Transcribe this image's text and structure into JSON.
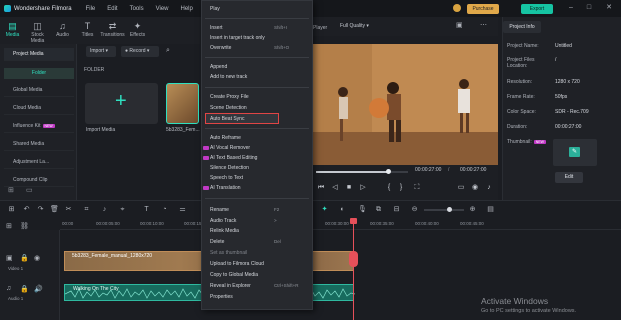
{
  "titlebar": {
    "app_name": "Wondershare Filmora",
    "menus": [
      "File",
      "Edit",
      "Tools",
      "View",
      "Help"
    ],
    "purchase": "Purchase",
    "export": "Export"
  },
  "tooltabs": [
    {
      "icon": "media-icon",
      "glyph": "▤",
      "label": "Media"
    },
    {
      "icon": "stock-media-icon",
      "glyph": "◫",
      "label": "Stock Media"
    },
    {
      "icon": "audio-icon",
      "glyph": "♫",
      "label": "Audio"
    },
    {
      "icon": "titles-icon",
      "glyph": "T",
      "label": "Titles"
    },
    {
      "icon": "transitions-icon",
      "glyph": "⇄",
      "label": "Transitions"
    },
    {
      "icon": "effects-icon",
      "glyph": "✦",
      "label": "Effects"
    }
  ],
  "leftpanel": {
    "items": [
      "Project Media",
      "Folder",
      "Global Media",
      "Cloud Media",
      "Influence Kit",
      "Shared Media",
      "Adjustment La...",
      "Compound Clip"
    ],
    "new_badge": "NEW"
  },
  "media": {
    "import_btn": "Import",
    "record_btn": "Record",
    "folder_label": "FOLDER",
    "import_media": "Import Media",
    "clip_name": "5b3283_Fem..."
  },
  "player": {
    "label": "Player",
    "quality": "Full Quality",
    "time_current": "00:00:27:00",
    "time_total": "00:00:27:00"
  },
  "context_menu": [
    {
      "label": "Play",
      "shortcut": "",
      "disabled": false,
      "ai": false
    },
    {
      "label": "Insert",
      "shortcut": "Shift+I",
      "disabled": false,
      "ai": false
    },
    {
      "label": "Insert in target track only",
      "shortcut": "",
      "disabled": false,
      "ai": false
    },
    {
      "label": "Overwrite",
      "shortcut": "Shift+O",
      "disabled": false,
      "ai": false
    },
    {
      "label": "Append",
      "shortcut": "",
      "disabled": false,
      "ai": false
    },
    {
      "label": "Add to new track",
      "shortcut": "",
      "disabled": false,
      "ai": false
    },
    {
      "label": "Create Proxy File",
      "shortcut": "",
      "disabled": false,
      "ai": false
    },
    {
      "label": "Scene Detection",
      "shortcut": "",
      "disabled": false,
      "ai": false
    },
    {
      "label": "Auto Beat Sync",
      "shortcut": "",
      "disabled": false,
      "ai": false
    },
    {
      "label": "Auto Reframe",
      "shortcut": "",
      "disabled": false,
      "ai": false
    },
    {
      "label": "AI Vocal Remover",
      "shortcut": "",
      "disabled": false,
      "ai": true
    },
    {
      "label": "AI Text Based Editing",
      "shortcut": "",
      "disabled": false,
      "ai": true
    },
    {
      "label": "Silence Detection",
      "shortcut": "",
      "disabled": false,
      "ai": false
    },
    {
      "label": "Speech to Text",
      "shortcut": "",
      "disabled": false,
      "ai": false
    },
    {
      "label": "AI Translation",
      "shortcut": "",
      "disabled": false,
      "ai": true
    },
    {
      "label": "Rename",
      "shortcut": "F2",
      "disabled": false,
      "ai": false
    },
    {
      "label": "Audio Track",
      "shortcut": ">",
      "disabled": false,
      "ai": false
    },
    {
      "label": "Relink Media",
      "shortcut": "",
      "disabled": false,
      "ai": false
    },
    {
      "label": "Delete",
      "shortcut": "Del",
      "disabled": false,
      "ai": false
    },
    {
      "label": "Set as thumbnail",
      "shortcut": "",
      "disabled": true,
      "ai": false
    },
    {
      "label": "Upload to Filmora Cloud",
      "shortcut": "",
      "disabled": false,
      "ai": false
    },
    {
      "label": "Copy to Global Media",
      "shortcut": "",
      "disabled": false,
      "ai": false
    },
    {
      "label": "Reveal in Explorer",
      "shortcut": "Ctrl+Shift+R",
      "disabled": false,
      "ai": false
    },
    {
      "label": "Properties",
      "shortcut": "",
      "disabled": false,
      "ai": false
    }
  ],
  "project_info": {
    "tab": "Project Info",
    "rows": [
      {
        "key": "Project Name:",
        "value": "Untitled"
      },
      {
        "key": "Project Files Location:",
        "value": "/"
      },
      {
        "key": "Resolution:",
        "value": "1280 x 720"
      },
      {
        "key": "Frame Rate:",
        "value": "50fps"
      },
      {
        "key": "Color Space:",
        "value": "SDR - Rec.709"
      },
      {
        "key": "Duration:",
        "value": "00:00:27:00"
      }
    ],
    "thumbnail_label": "Thumbnail:",
    "edit_btn": "Edit"
  },
  "timeline": {
    "ticks": [
      "00:00",
      "00:00:05:00",
      "00:00:10:00",
      "00:00:15:00",
      "00:00:20:00",
      "00:00:25:00",
      "00:00:30:00",
      "00:00:35:00",
      "00:00:40:00",
      "00:00:45:00"
    ],
    "video_clip": "5b3283_Female_manual_1280x720",
    "audio_clip": "Walking On The City",
    "track_video": "Video 1",
    "track_audio": "Audio 1"
  },
  "watermark": {
    "line1": "Activate Windows",
    "line2": "Go to PC settings to activate Windows."
  },
  "colors": {
    "accent": "#2fe0c0",
    "purchase": "#e0a84a",
    "playhead": "#e6505a",
    "highlight_border": "#e04545"
  }
}
